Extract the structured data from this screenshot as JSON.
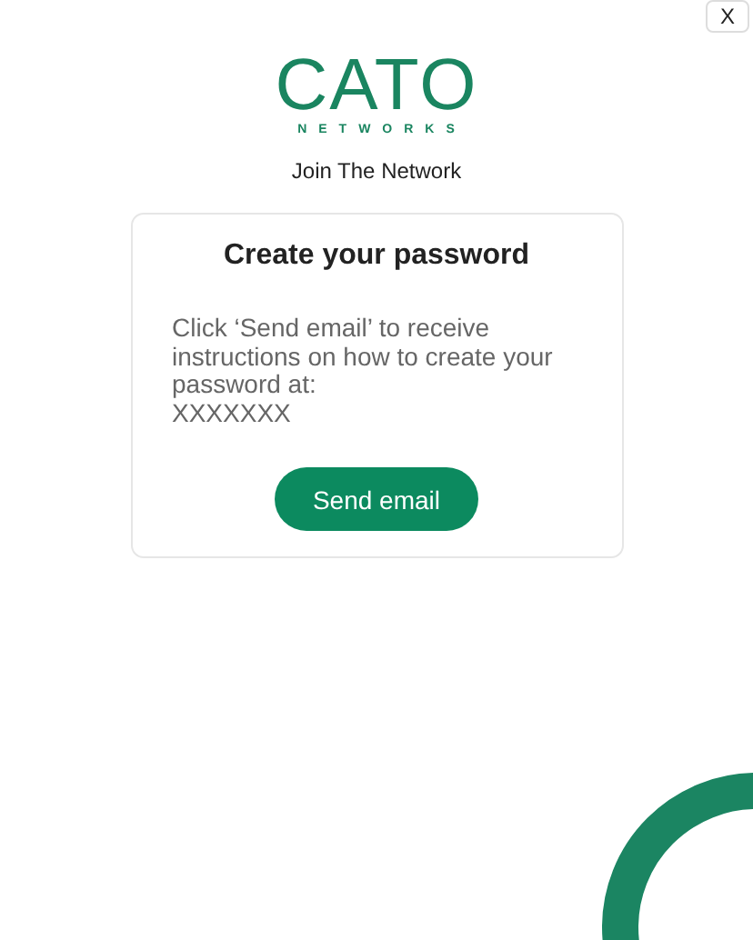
{
  "close_button": {
    "label": "X"
  },
  "logo": {
    "wordmark": "CATO",
    "tagline": "NETWORKS"
  },
  "subtitle": "Join The Network",
  "card": {
    "title": "Create your password",
    "message": "Click ‘Send email’ to receive instructions on how to create your password at:",
    "email": "XXXXXXX",
    "button": "Send email"
  }
}
